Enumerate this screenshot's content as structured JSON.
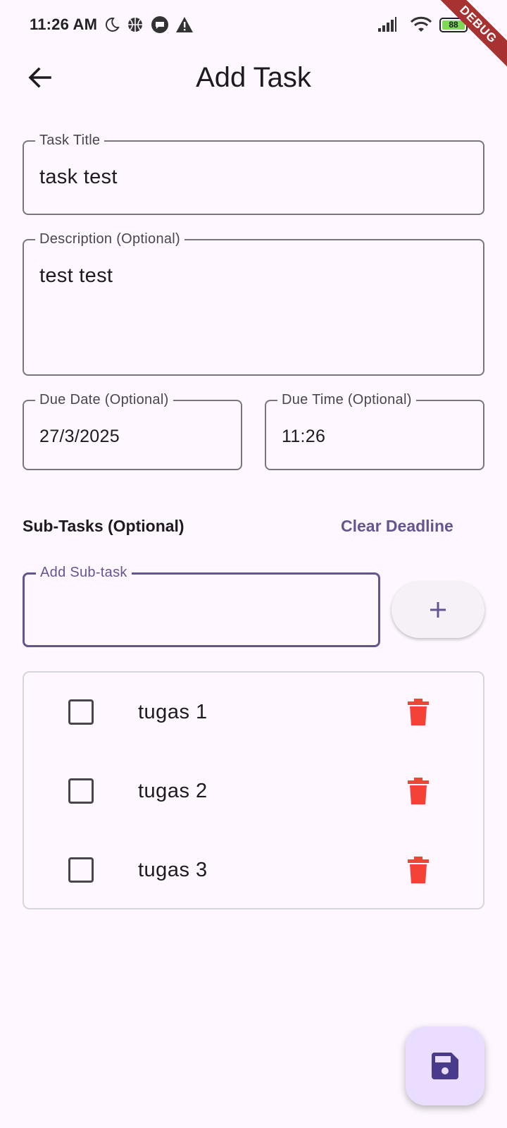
{
  "status_bar": {
    "time": "11:26 AM",
    "battery_level": "88",
    "debug_banner": "DEBUG",
    "icons": [
      "moon-icon",
      "basketball-icon",
      "message-icon",
      "warning-icon",
      "signal-icon",
      "wifi-icon",
      "battery-icon",
      "charging-icon"
    ]
  },
  "app_bar": {
    "title": "Add Task",
    "back_icon": "arrow-back-icon"
  },
  "form": {
    "task_title": {
      "label": "Task Title",
      "value": "task test"
    },
    "description": {
      "label": "Description (Optional)",
      "value": "test test"
    },
    "due_date": {
      "label": "Due Date (Optional)",
      "value": "27/3/2025"
    },
    "due_time": {
      "label": "Due Time (Optional)",
      "value": "11:26"
    }
  },
  "subtasks_section": {
    "title": "Sub-Tasks (Optional)",
    "clear_deadline_label": "Clear Deadline",
    "add_field": {
      "label": "Add Sub-task",
      "value": ""
    },
    "add_button_icon": "plus-icon",
    "items": [
      {
        "label": "tugas 1",
        "checked": false
      },
      {
        "label": "tugas 2",
        "checked": false
      },
      {
        "label": "tugas 3",
        "checked": false
      }
    ]
  },
  "fab": {
    "icon": "save-icon"
  },
  "colors": {
    "background": "#fef7ff",
    "primary": "#65558f",
    "outline": "#79747e",
    "delete": "#f44336",
    "fab_bg": "#eaddff",
    "fab_icon": "#4a3a8a"
  }
}
